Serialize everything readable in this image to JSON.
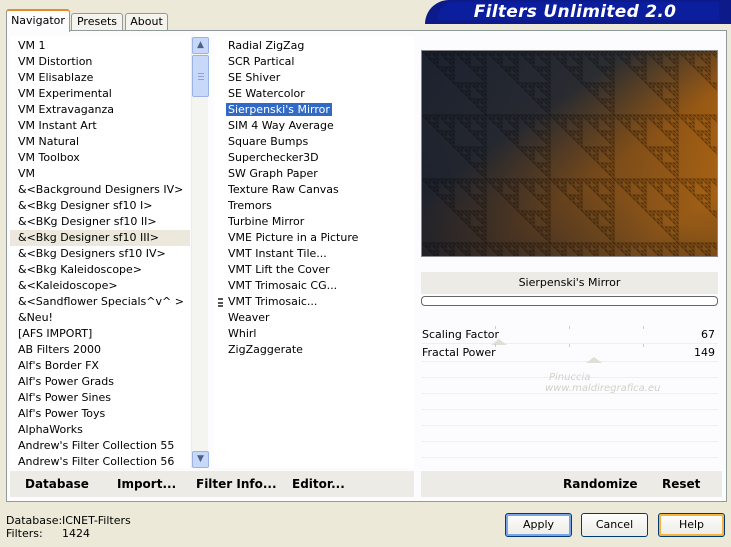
{
  "tabs": [
    {
      "label": "Navigator",
      "active": true
    },
    {
      "label": "Presets",
      "active": false
    },
    {
      "label": "About",
      "active": false
    }
  ],
  "banner": {
    "title": "Filters Unlimited 2.0"
  },
  "categories": [
    "VM 1",
    "VM Distortion",
    "VM Elisablaze",
    "VM Experimental",
    "VM Extravaganza",
    "VM Instant Art",
    "VM Natural",
    "VM Toolbox",
    "VM",
    "&<Background Designers IV>",
    "&<Bkg Designer sf10 I>",
    "&<BKg Designer sf10 II>",
    "&<Bkg Designer sf10 III>",
    "&<Bkg Designers sf10 IV>",
    "&<Bkg Kaleidoscope>",
    "&<Kaleidoscope>",
    "&<Sandflower Specials^v^ >",
    "&Neu!",
    "[AFS IMPORT]",
    "AB Filters 2000",
    "Alf's Border FX",
    "Alf's Power Grads",
    "Alf's Power Sines",
    "Alf's Power Toys",
    "AlphaWorks",
    "Andrew's Filter Collection 55",
    "Andrew's Filter Collection 56"
  ],
  "selected_category": "&<Bkg Designer sf10 III>",
  "filters": [
    "Radial ZigZag",
    "SCR  Partical",
    "SE Shiver",
    "SE Watercolor",
    "Sierpenski's Mirror",
    "SIM 4 Way Average",
    "Square Bumps",
    "Superchecker3D",
    "SW Graph Paper",
    "Texture Raw Canvas",
    "Tremors",
    "Turbine Mirror",
    "VME Picture in a Picture",
    "VMT Instant Tile...",
    "VMT Lift the Cover",
    "VMT Trimosaic CG...",
    "VMT Trimosaic...",
    "Weaver",
    "Whirl",
    "ZigZaggerate"
  ],
  "selected_filter": "Sierpenski's Mirror",
  "marked_filter": "VMT Trimosaic...",
  "filter_name": "Sierpenski's Mirror",
  "progress": 0,
  "params": [
    {
      "name": "Scaling Factor",
      "value": "67"
    },
    {
      "name": "Fractal Power",
      "value": "149"
    }
  ],
  "watermark": {
    "line1": "Pinuccia",
    "line2": "www.maldiregrafica.eu"
  },
  "toolbar": {
    "database": "Database",
    "import": "Import...",
    "filter_info": "Filter Info...",
    "editor": "Editor...",
    "randomize": "Randomize",
    "reset": "Reset"
  },
  "status": {
    "database_label": "Database:",
    "database_value": "ICNET-Filters",
    "filters_label": "Filters:",
    "filters_value": "1424"
  },
  "buttons": {
    "apply": "Apply",
    "cancel": "Cancel",
    "help": "Help"
  },
  "colors": {
    "accent": "#316ac5",
    "banner": "#0c1a8a",
    "preview_orange": "#c9730f",
    "preview_dark": "#1c2230"
  }
}
